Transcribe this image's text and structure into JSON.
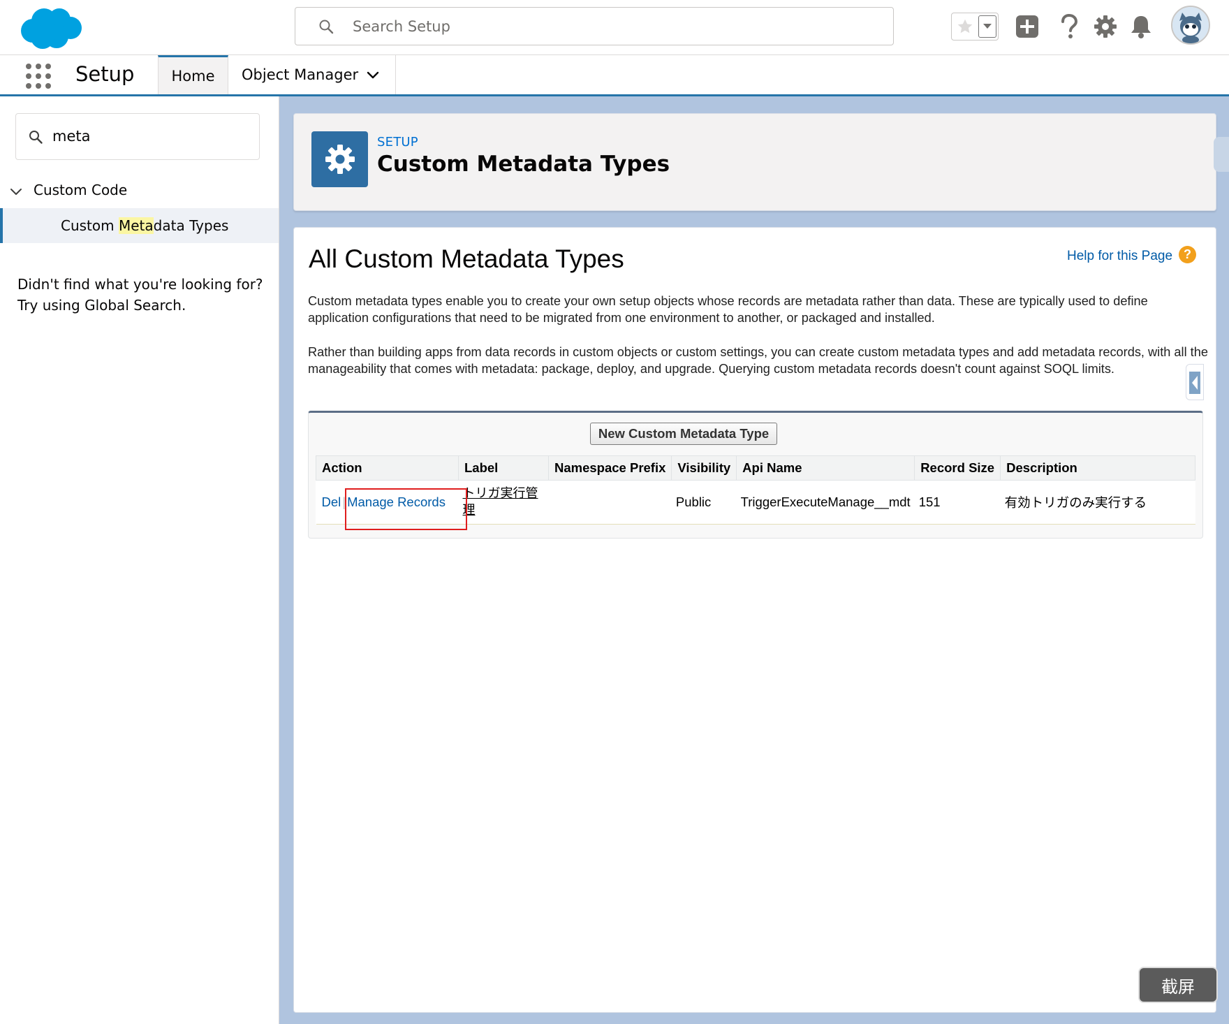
{
  "header": {
    "search_placeholder": "Search Setup"
  },
  "context_bar": {
    "app_name": "Setup",
    "tabs": [
      {
        "label": "Home"
      },
      {
        "label": "Object Manager"
      }
    ]
  },
  "sidebar": {
    "quickfind_value": "meta",
    "tree_header": "Custom Code",
    "tree_item_pre": "Custom ",
    "tree_item_match": "Meta",
    "tree_item_post": "data Types",
    "not_found_line1": "Didn't find what you're looking for?",
    "not_found_line2": "Try using Global Search."
  },
  "page_header": {
    "eyebrow": "SETUP",
    "title": "Custom Metadata Types"
  },
  "main": {
    "title": "All Custom Metadata Types",
    "help_link": "Help for this Page",
    "help_icon_glyph": "?",
    "description_1": "Custom metadata types enable you to create your own setup objects whose records are metadata rather than data. These are typically used to define application configurations that need to be migrated from one environment to another, or packaged and installed.",
    "description_2": "Rather than building apps from data records in custom objects or custom settings, you can create custom metadata types and add metadata records, with all the manageability that comes with metadata: package, deploy, and upgrade. Querying custom metadata records doesn't count against SOQL limits.",
    "new_button": "New Custom Metadata Type",
    "columns": [
      "Action",
      "Label",
      "Namespace Prefix",
      "Visibility",
      "Api Name",
      "Record Size",
      "Description"
    ],
    "rows": [
      {
        "action_del": "Del",
        "action_sep": "|",
        "action_manage": "Manage Records",
        "label": "トリガ実行管理",
        "namespace_prefix": "",
        "visibility": "Public",
        "api_name": "TriggerExecuteManage__mdt",
        "record_size": "151",
        "description": "有効トリガのみ実行する"
      }
    ]
  },
  "overlay": {
    "screenshot_button": "截屏"
  },
  "colors": {
    "brand_blue": "#00a1e0",
    "link_blue": "#015ba7",
    "setup_icon_bg": "#2e6ea3",
    "highlight_red": "#e01e1e",
    "help_orange": "#f2a01c"
  },
  "icons": [
    "salesforce-logo",
    "search-icon",
    "star-icon",
    "chevron-down-icon",
    "plus-icon",
    "question-icon",
    "gear-icon",
    "bell-icon",
    "avatar",
    "app-launcher-icon",
    "setup-gear-icon",
    "help-icon"
  ]
}
